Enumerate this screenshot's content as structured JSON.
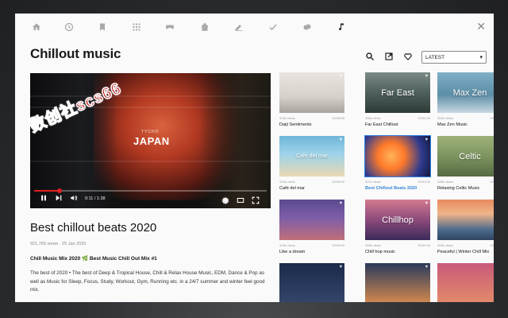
{
  "nav": {
    "icons": [
      "home-icon",
      "history-icon",
      "bookmark-icon",
      "apps-icon",
      "gamepad-icon",
      "bag-icon",
      "pen-icon",
      "check-icon",
      "cloud-icon",
      "music-icon"
    ],
    "close": "✕"
  },
  "page": {
    "title": "Chillout music"
  },
  "tools": {
    "search": "search-icon",
    "open": "open-external-icon",
    "favorite": "heart-icon"
  },
  "sort": {
    "selected": "LATEST"
  },
  "player": {
    "artist_overlay": "TYCHO",
    "title_overlay": "JAPAN",
    "current_time": "0:11 / 1:38",
    "progress": 0.11
  },
  "watermark": "数创社scs66",
  "video": {
    "title": "Best chillout beats 2020",
    "meta": "921,765 views · 25 Jan 2020",
    "desc_title": "Chill Music Mix 2020 🌿 Best Music Chill Out Mix #1",
    "description": "The best of 2020 • The best of Deep & Tropical House, Chill & Relax House Music, EDM, Dance & Pop as well as Music for Sleep, Focus, Study, Workout, Gym, Running etc. in a 24/7 summer and winter feel good mix."
  },
  "cards": [
    {
      "title": "Daiji Sentiments",
      "views": "315k views",
      "duration": "00:58:56",
      "overlay": "",
      "bg": "linear-gradient(180deg,#e8e4df 0%,#d6d1cb 60%,#a8a39c 100%)"
    },
    {
      "title": "Far East Chillout",
      "views": "458k views",
      "duration": "00:52:00",
      "overlay": "Far East",
      "bg": "linear-gradient(180deg,#7b8a86 0%,#4e605c 50%,#2d3a37 100%)"
    },
    {
      "title": "Max Zen Music",
      "views": "453k views",
      "duration": "00:52:24",
      "overlay": "Max Zen",
      "bg": "linear-gradient(180deg,#7fb0c6 0%,#5d8ea8 55%,#c8d8e0 100%)"
    },
    {
      "title": "Café del mar",
      "views": "243k views",
      "duration": "00:59:59",
      "overlay": "Café del mar",
      "bg": "linear-gradient(180deg,#6fb6d8 0%,#9ed4ea 45%,#e9d8b0 100%)"
    },
    {
      "title": "Best Chillout Beats 2020",
      "views": "921k views",
      "duration": "00:52:00",
      "overlay": "",
      "bg": "radial-gradient(circle at 40% 50%,#ffb25a 0%,#ff7a2a 30%,#2e3b8f 70%,#14183a 100%)"
    },
    {
      "title": "Relaxing Celtic Music",
      "views": "488k views",
      "duration": "00:52:34",
      "overlay": "Celtic",
      "bg": "linear-gradient(180deg,#9fb27a 0%,#7d9460 50%,#566b43 100%)"
    },
    {
      "title": "Like a dream",
      "views": "315k views",
      "duration": "00:59:59",
      "overlay": "",
      "bg": "linear-gradient(180deg,#5b4a8e 0%,#7d5ea8 45%,#c06f7a 100%)"
    },
    {
      "title": "Chill hop music",
      "views": "458k views",
      "duration": "00:52:00",
      "overlay": "Chillhop",
      "bg": "linear-gradient(180deg,#d27b8f 0%,#8c4a7b 50%,#3b2a5a 100%)"
    },
    {
      "title": "Peaceful | Winter Chill Mix",
      "views": "453k views",
      "duration": "00:52:24",
      "overlay": "",
      "bg": "linear-gradient(180deg,#e88b5e 0%,#f0b48a 35%,#4a6a8c 75%,#2e4560 100%)"
    },
    {
      "title": "",
      "views": "",
      "duration": "",
      "overlay": "",
      "bg": "linear-gradient(180deg,#1b2a4a 0%,#34466a 100%)"
    },
    {
      "title": "",
      "views": "",
      "duration": "",
      "overlay": "",
      "bg": "linear-gradient(180deg,#2a3a5c 0%,#d58a4e 100%)"
    },
    {
      "title": "",
      "views": "",
      "duration": "",
      "overlay": "",
      "bg": "linear-gradient(180deg,#c85a7a 0%,#e38b6a 100%)"
    }
  ]
}
